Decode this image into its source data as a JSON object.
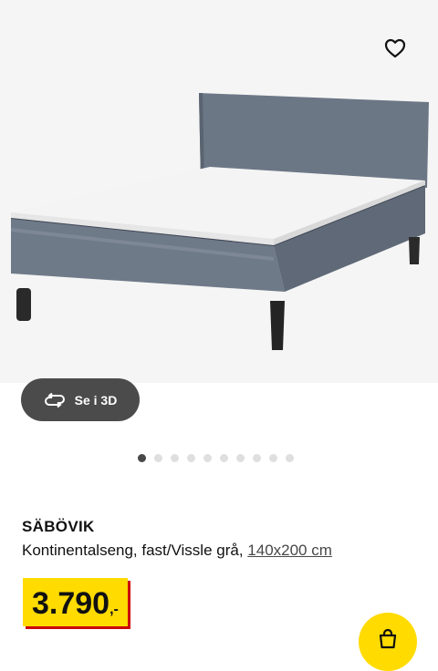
{
  "product": {
    "name": "SÄBÖVIK",
    "description": "Kontinentalseng, fast/Vissle grå, ",
    "size": "140x200 cm",
    "price_int": "3.790",
    "price_dec": ",-"
  },
  "gallery": {
    "view3d_label": "Se i 3D",
    "dot_count": 10,
    "active_dot": 0
  },
  "icons": {
    "favorite": "heart-outline-icon",
    "rotate": "rotate-3d-icon",
    "cart": "shopping-bag-icon"
  },
  "colors": {
    "price_yellow": "#ffdb00",
    "price_shadow": "#cc0008",
    "pill_bg": "#4b4b4b",
    "bed_fabric": "#6f7a88"
  }
}
